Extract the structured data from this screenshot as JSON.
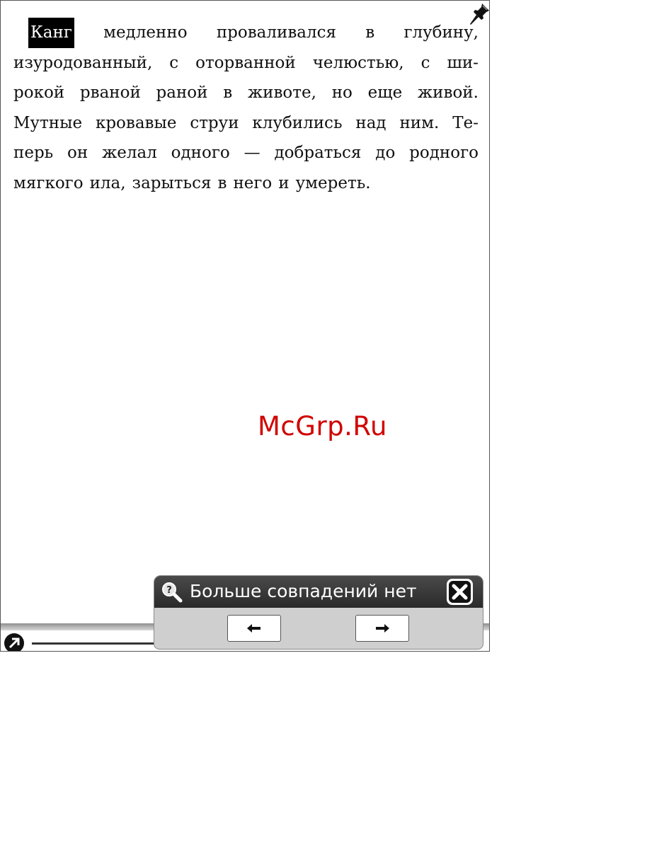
{
  "book": {
    "highlighted_word": "Канг",
    "lines": [
      [
        "медленно",
        "проваливался",
        "в",
        "глубину,"
      ],
      [
        "изуродованный,",
        "с",
        "оторванной",
        "челюстью,",
        "с",
        "ши-"
      ],
      [
        "рокой",
        "рваной",
        "раной",
        "в",
        "животе,",
        "но",
        "еще",
        "живой."
      ],
      [
        "Мутные",
        "кровавые",
        "струи",
        "клубились",
        "над",
        "ним.",
        "Те-"
      ],
      [
        "перь",
        "он",
        "желал",
        "одного",
        "—",
        "добраться",
        "до",
        "родного"
      ],
      [
        "мягкого",
        "ила,",
        "зарыться",
        "в",
        "него",
        "и",
        "умереть."
      ]
    ]
  },
  "watermark": "McGrp.Ru",
  "search_popup": {
    "message": "Больше совпадений нет",
    "prev_icon": "arrow-left-icon",
    "next_icon": "arrow-right-icon",
    "close_icon": "close-icon"
  },
  "status_bar": {
    "nav_icon": "arrow-up-right-icon"
  },
  "colors": {
    "highlight": "#000000",
    "popup_header": "#333333",
    "watermark": "#d10000"
  }
}
